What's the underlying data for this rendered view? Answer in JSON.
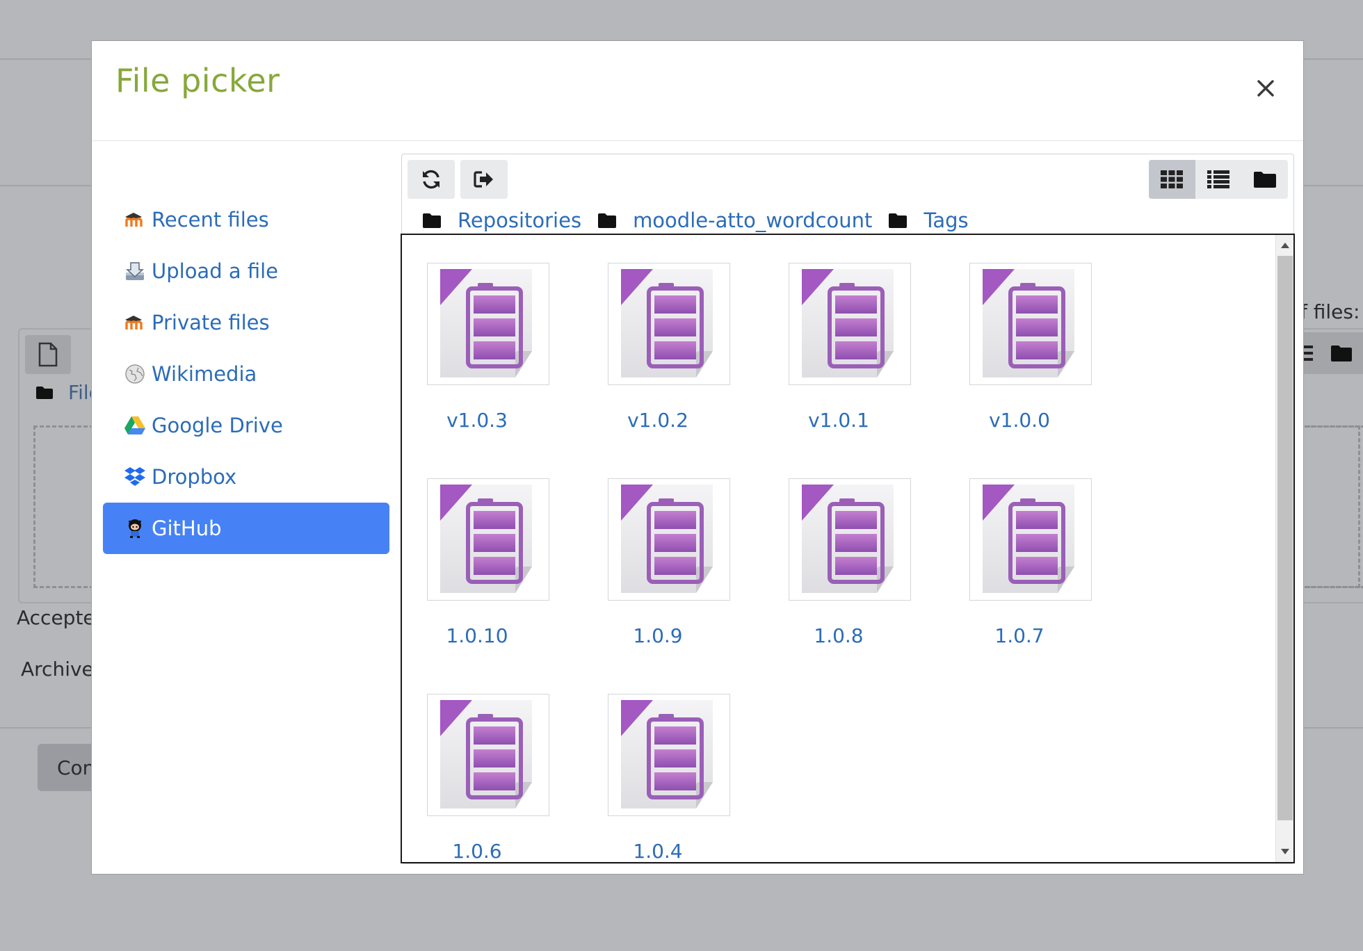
{
  "background": {
    "files_label": "File",
    "accepted_label": "Accepte",
    "archive_label": "Archive",
    "continue_button": "Con",
    "max_files_label": "f files:"
  },
  "modal": {
    "title": "File picker",
    "close_label": "×"
  },
  "sidebar": {
    "items": [
      {
        "label": "Recent files",
        "icon": "moodle-icon",
        "active": false
      },
      {
        "label": "Upload a file",
        "icon": "upload-icon",
        "active": false
      },
      {
        "label": "Private files",
        "icon": "moodle-icon",
        "active": false
      },
      {
        "label": "Wikimedia",
        "icon": "wikimedia-icon",
        "active": false
      },
      {
        "label": "Google Drive",
        "icon": "google-drive-icon",
        "active": false
      },
      {
        "label": "Dropbox",
        "icon": "dropbox-icon",
        "active": false
      },
      {
        "label": "GitHub",
        "icon": "github-icon",
        "active": true
      }
    ]
  },
  "toolbar": {
    "refresh_icon": "refresh-icon",
    "logout_icon": "logout-icon",
    "view_modes": [
      "icons-view",
      "list-view",
      "tree-view"
    ],
    "active_view": "icons-view"
  },
  "path": [
    {
      "label": "Repositories"
    },
    {
      "label": "moodle-atto_wordcount"
    },
    {
      "label": "Tags"
    }
  ],
  "files": [
    {
      "label": "v1.0.3"
    },
    {
      "label": "v1.0.2"
    },
    {
      "label": "v1.0.1"
    },
    {
      "label": "v1.0.0"
    },
    {
      "label": "1.0.10"
    },
    {
      "label": "1.0.9"
    },
    {
      "label": "1.0.8"
    },
    {
      "label": "1.0.7"
    },
    {
      "label": "1.0.6"
    },
    {
      "label": "1.0.4"
    }
  ],
  "colors": {
    "title": "#86a83a",
    "link": "#2b6cb8",
    "active_item": "#4682f5",
    "archive_purple": "#9b5fb8"
  }
}
